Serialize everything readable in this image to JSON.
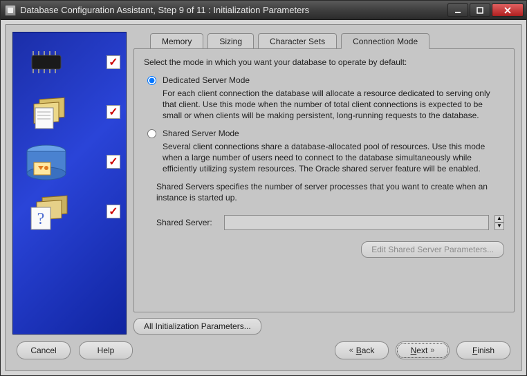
{
  "window": {
    "title": "Database Configuration Assistant, Step 9 of 11 : Initialization Parameters"
  },
  "tabs": [
    {
      "label": "Memory",
      "active": false
    },
    {
      "label": "Sizing",
      "active": false
    },
    {
      "label": "Character Sets",
      "active": false
    },
    {
      "label": "Connection Mode",
      "active": true
    }
  ],
  "panel": {
    "intro": "Select the mode in which you want your database to operate by default:",
    "options": {
      "dedicated": {
        "title": "Dedicated Server Mode",
        "desc": "For each client connection the database will allocate a resource dedicated to serving only that client.  Use this mode when the number of total client connections is expected to be small or when clients will be making persistent, long-running requests to the database.",
        "selected": true
      },
      "shared": {
        "title": "Shared Server Mode",
        "desc": "Several client connections share a database-allocated pool of resources.  Use this mode when a large number of users need to connect to the database simultaneously while efficiently utilizing system resources.  The Oracle shared server feature will be enabled.",
        "selected": false
      }
    },
    "shared_note": "Shared Servers specifies the number of server processes that you want to create when an instance is started up.",
    "shared_server": {
      "label": "Shared Server:",
      "value": ""
    },
    "edit_shared_btn": "Edit Shared Server Parameters...",
    "all_params_btn": "All Initialization Parameters..."
  },
  "footer": {
    "cancel": "Cancel",
    "help": "Help",
    "back": "Back",
    "next": "Next",
    "finish": "Finish"
  },
  "sidebar": {
    "items": [
      {
        "name": "chip",
        "checked": true
      },
      {
        "name": "folders",
        "checked": true
      },
      {
        "name": "db-storage",
        "checked": true
      },
      {
        "name": "help-folders",
        "checked": true
      }
    ]
  }
}
